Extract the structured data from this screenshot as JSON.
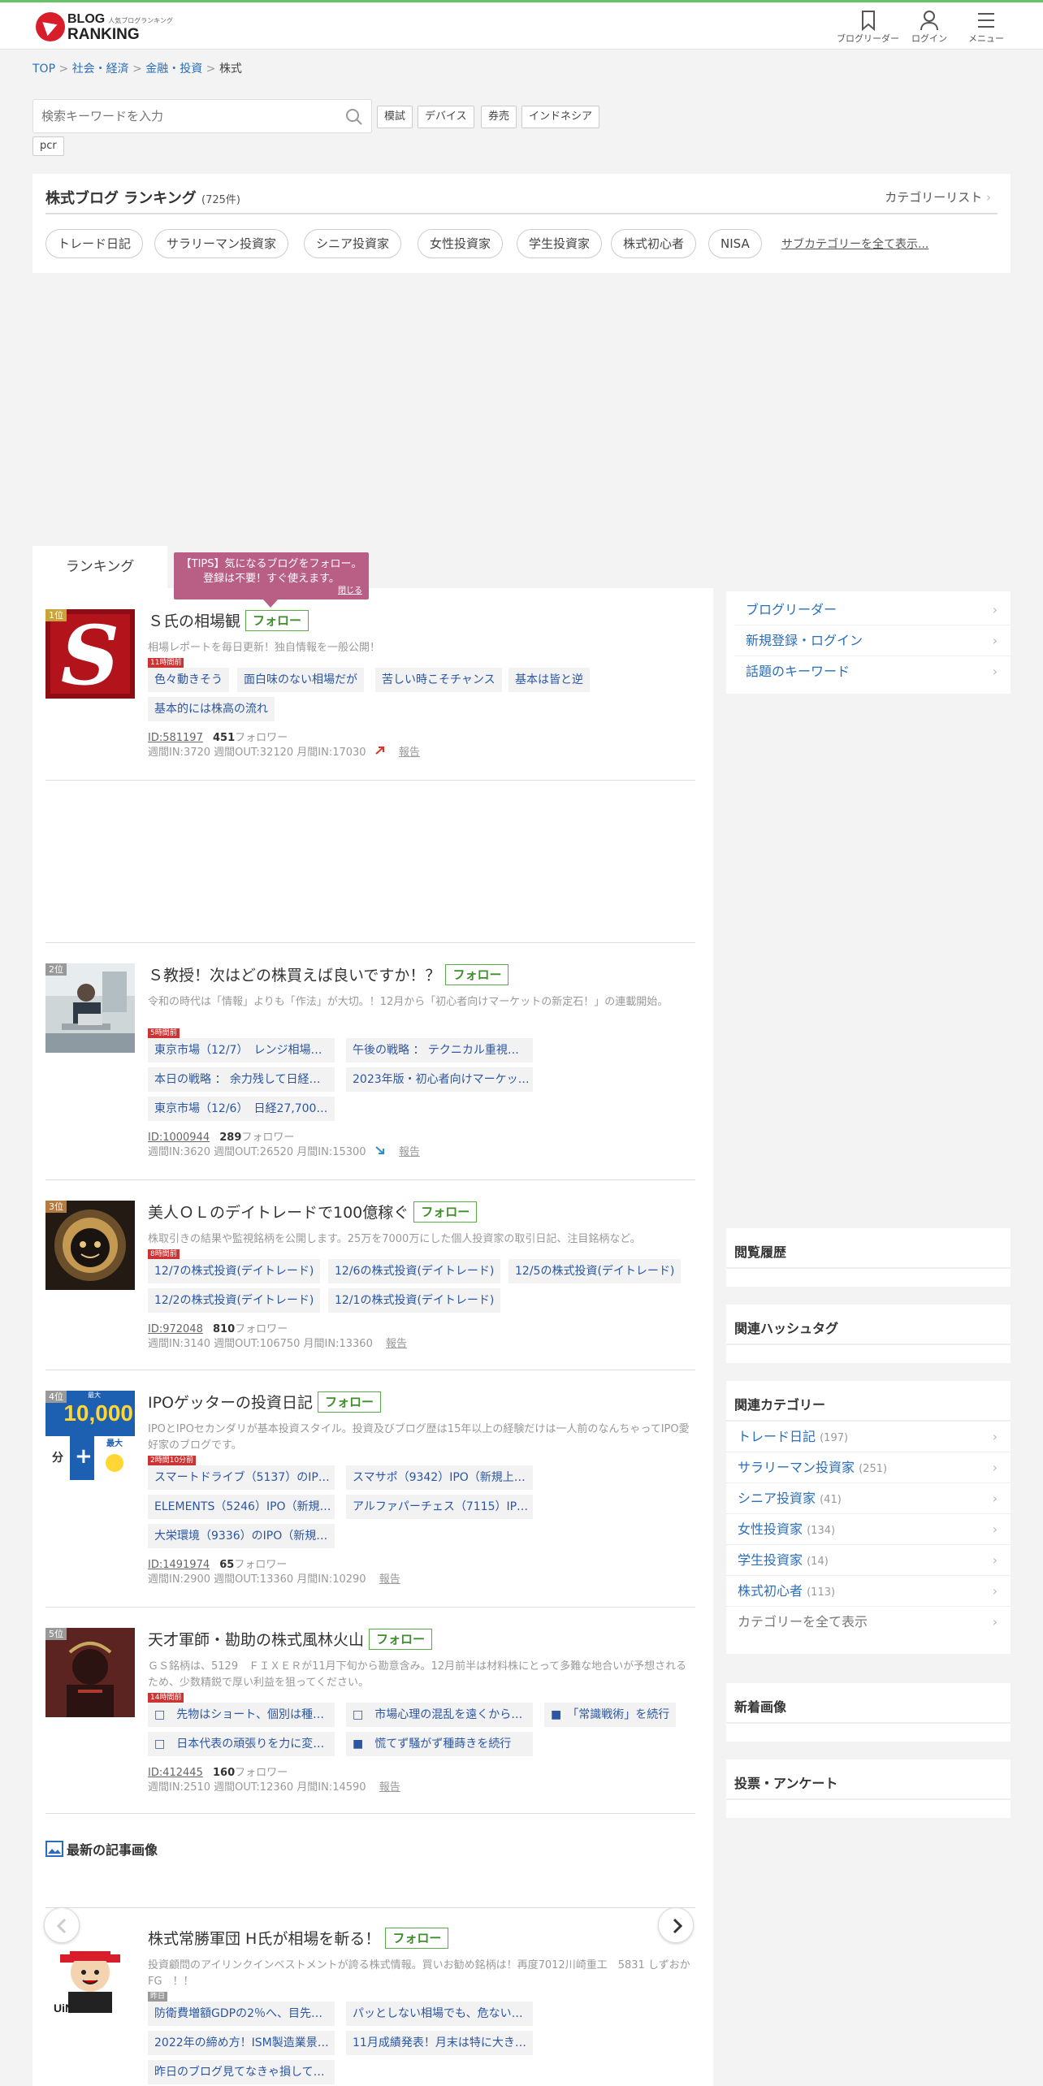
{
  "header": {
    "logo_small": "人気ブログランキング",
    "logo_line1": "BLOG",
    "logo_line2": "RANKING",
    "nav": [
      {
        "label": "ブログリーダー",
        "icon": "bookmark-icon"
      },
      {
        "label": "ログイン",
        "icon": "user-icon"
      },
      {
        "label": "メニュー",
        "icon": "hamburger-icon"
      }
    ]
  },
  "breadcrumb": {
    "items": [
      "TOP",
      "社会・経済",
      "金融・投資"
    ],
    "current": "株式",
    "separator": ">"
  },
  "search": {
    "placeholder": "検索キーワードを入力",
    "keywords": [
      "模試",
      "デバイス",
      "券売",
      "インドネシア",
      "pcr"
    ]
  },
  "category": {
    "title": "株式ブログ ランキング",
    "count": "(725件)",
    "list_link": "カテゴリーリスト",
    "chips": [
      "トレード日記",
      "サラリーマン投資家",
      "シニア投資家",
      "女性投資家",
      "学生投資家",
      "株式初心者",
      "NISA"
    ],
    "show_all": "サブカテゴリーを全て表示..."
  },
  "tabs": {
    "ranking": "ランキング"
  },
  "tips": {
    "line1": "【TIPS】気になるブログをフォロー。",
    "line2": "登録は不要！すぐ使えます。",
    "close": "閉じる"
  },
  "follow_label": "フォロー",
  "entries": [
    {
      "rank": "1位",
      "title": "Ｓ氏の相場観",
      "desc": "相場レポートを毎日更新！独自情報を一般公開！",
      "time": "11時間前",
      "articles": [
        "色々動きそう",
        "面白味のない相場だが",
        "苦しい時こそチャンス",
        "基本は皆と逆",
        "基本的には株高の流れ"
      ],
      "id": "ID:581197",
      "followers": "451",
      "followers_label": "フォロワー",
      "stats": "週間IN:3720  週間OUT:32120  月間IN:17030",
      "trend": "up",
      "report": "報告"
    },
    {
      "rank": "2位",
      "title": "Ｓ教授！次はどの株買えば良いですか！？",
      "desc": "令和の時代は「情報」よりも「作法」が大切。！12月から「初心者向けマーケットの新定石！」の連載開始。",
      "time": "5時間前",
      "articles": [
        "東京市場（12/7）　レンジ相場…",
        "午後の戦略 ： テクニカル重視…",
        "本日の戦略 ： 余力残して日経…",
        "2023年版・初心者向けマーケッ…",
        "東京市場（12/6）　日経27,700…"
      ],
      "id": "ID:1000944",
      "followers": "289",
      "followers_label": "フォロワー",
      "stats": "週間IN:3620  週間OUT:26520  月間IN:15300",
      "trend": "down",
      "report": "報告"
    },
    {
      "rank": "3位",
      "title": "美人ＯＬのデイトレードで100億稼ぐ",
      "desc": "株取引きの結果や監視銘柄を公開します。25万を7000万にした個人投資家の取引日記、注目銘柄など。",
      "time": "8時間前",
      "articles": [
        "12/7の株式投資(デイトレード)",
        "12/6の株式投資(デイトレード)",
        "12/5の株式投資(デイトレード)",
        "12/2の株式投資(デイトレード)",
        "12/1の株式投資(デイトレード)"
      ],
      "id": "ID:972048",
      "followers": "810",
      "followers_label": "フォロワー",
      "stats": "週間IN:3140  週間OUT:106750  月間IN:13360",
      "trend": "",
      "report": "報告"
    },
    {
      "rank": "4位",
      "title": "IPOゲッターの投資日記",
      "desc": "IPOとIPOセカンダリが基本投資スタイル。投資及びブログ歴は15年以上の経験だけは一人前のなんちゃってIPO愛好家のブログです。",
      "time": "2時間10分前",
      "thumb_text": "10,000",
      "thumb_small": "最大",
      "thumb_bottom_left": "分",
      "thumb_bottom_right": "最大",
      "articles": [
        "スマートドライブ（5137）のIP…",
        "スマサポ（9342）IPO（新規上…",
        "ELEMENTS（5246）IPO（新規…",
        "アルファパーチェス（7115）IP…",
        "大栄環境（9336）のIPO（新規…"
      ],
      "id": "ID:1491974",
      "followers": "65",
      "followers_label": "フォロワー",
      "stats": "週間IN:2900  週間OUT:13360  月間IN:10290",
      "trend": "",
      "report": "報告"
    },
    {
      "rank": "5位",
      "title": "天才軍師・勘助の株式風林火山",
      "desc": "ＧＳ銘柄は、5129　ＦＩＸＥＲが11月下旬から勘意含み。12月前半は材料株にとって多難な地合いが予想されるため、少数精鋭で厚い利益を狙ってください。",
      "time": "14時間前",
      "articles": [
        "□　先物はショート、個別は種…",
        "□　市場心理の混乱を遠くから…",
        "■　「常識戦術」を続行",
        "□　日本代表の頑張りを力に変…",
        "■　慌てず騒がず種蒔きを続行"
      ],
      "id": "ID:412445",
      "followers": "160",
      "followers_label": "フォロワー",
      "stats": "週間IN:2510  週間OUT:12360  月間IN:14590",
      "trend": "",
      "report": "報告"
    },
    {
      "rank": "",
      "title": "株式常勝軍団 H氏が相場を斬る！",
      "desc": "投資顧問のアイリンクインベストメントが誇る株式情報。買いお勧め銘柄は！再度7012川崎重工　5831 しずおかFG　！！",
      "time": "昨日",
      "thumb_text": "UiNK",
      "articles": [
        "防衛費増額GDPの2％へ、目先…",
        "パッとしない相場でも、危ない…",
        "2022年の締め方！ISM製造業景…",
        "11月成績発表！月末は特に大き…",
        "昨日のブログ見てなきゃ損して…"
      ]
    }
  ],
  "latest_images": "最新の記事画像",
  "sidebar": {
    "links": [
      "ブログリーダー",
      "新規登録・ログイン",
      "話題のキーワード"
    ],
    "history": "閲覧履歴",
    "hashtags": "関連ハッシュタグ",
    "related": "関連カテゴリー",
    "related_items": [
      {
        "name": "トレード日記",
        "count": "(197)"
      },
      {
        "name": "サラリーマン投資家",
        "count": "(251)"
      },
      {
        "name": "シニア投資家",
        "count": "(41)"
      },
      {
        "name": "女性投資家",
        "count": "(134)"
      },
      {
        "name": "学生投資家",
        "count": "(14)"
      },
      {
        "name": "株式初心者",
        "count": "(113)"
      }
    ],
    "show_all": "カテゴリーを全て表示",
    "new_images": "新着画像",
    "vote": "投票・アンケート"
  },
  "colors": {
    "accent_green": "#65c466",
    "link_blue": "#2a6ebb",
    "tips_bg": "#b95f86",
    "logo_red": "#d81e2b"
  }
}
